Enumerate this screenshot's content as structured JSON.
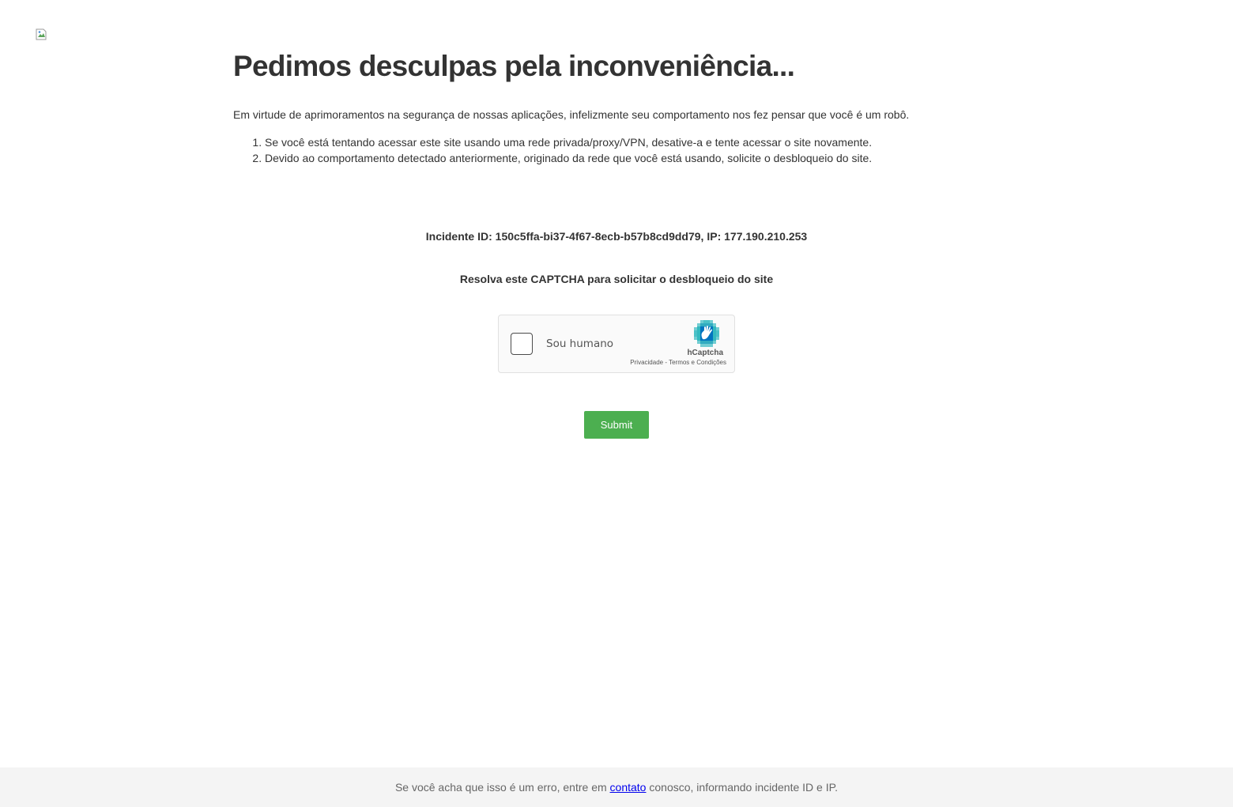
{
  "logo": {
    "icon": "broken-image-icon"
  },
  "header": {
    "title": "Pedimos desculpas pela inconveniência..."
  },
  "main": {
    "intro": "Em virtude de aprimoramentos na segurança de nossas aplicações, infelizmente seu comportamento nos fez pensar que você é um robô.",
    "steps": [
      "Se você está tentando acessar este site usando uma rede privada/proxy/VPN, desative-a e tente acessar o site novamente.",
      "Devido ao comportamento detectado anteriormente, originado da rede que você está usando, solicite o desbloqueio do site."
    ],
    "incident": "Incidente ID: 150c5ffa-bi37-4f67-8ecb-b57b8cd9dd79, IP: 177.190.210.253",
    "captcha_prompt": "Resolva este CAPTCHA para solicitar o desbloqueio do site"
  },
  "captcha": {
    "checkbox_label": "Sou humano",
    "brand": "hCaptcha",
    "privacy_link": "Privacidade",
    "separator": " - ",
    "terms_link": "Termos e Condições",
    "logo_icon": "hcaptcha-hand-icon"
  },
  "form": {
    "submit_label": "Submit",
    "submit_color": "#4caf50"
  },
  "footer": {
    "text_before": "Se você acha que isso é um erro, entre em ",
    "link_text": "contato",
    "text_after": " conosco, informando incidente ID e IP."
  }
}
